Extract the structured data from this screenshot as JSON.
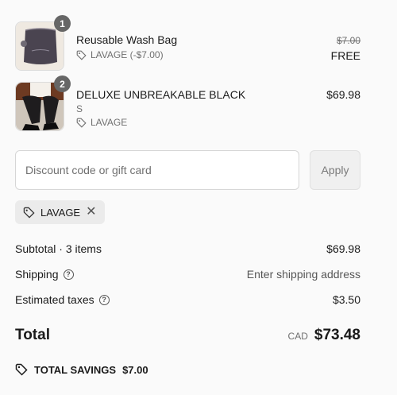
{
  "items": [
    {
      "quantity": "1",
      "name": "Reusable Wash Bag",
      "variant": "",
      "discount": "LAVAGE (-$7.00)",
      "original_price": "$7.00",
      "price": "FREE"
    },
    {
      "quantity": "2",
      "name": "DELUXE UNBREAKABLE BLACK",
      "variant": "S",
      "discount": "LAVAGE",
      "original_price": "",
      "price": "$69.98"
    }
  ],
  "discount": {
    "placeholder": "Discount code or gift card",
    "apply_label": "Apply",
    "applied_code": "LAVAGE"
  },
  "summary": {
    "subtotal_label": "Subtotal · 3 items",
    "subtotal_value": "$69.98",
    "shipping_label": "Shipping",
    "shipping_value": "Enter shipping address",
    "taxes_label": "Estimated taxes",
    "taxes_value": "$3.50",
    "total_label": "Total",
    "currency": "CAD",
    "total_value": "$73.48",
    "savings_label": "TOTAL SAVINGS",
    "savings_value": "$7.00"
  },
  "icons": {
    "tag": "tag-icon",
    "help": "help-circle-icon",
    "remove": "close-icon"
  }
}
